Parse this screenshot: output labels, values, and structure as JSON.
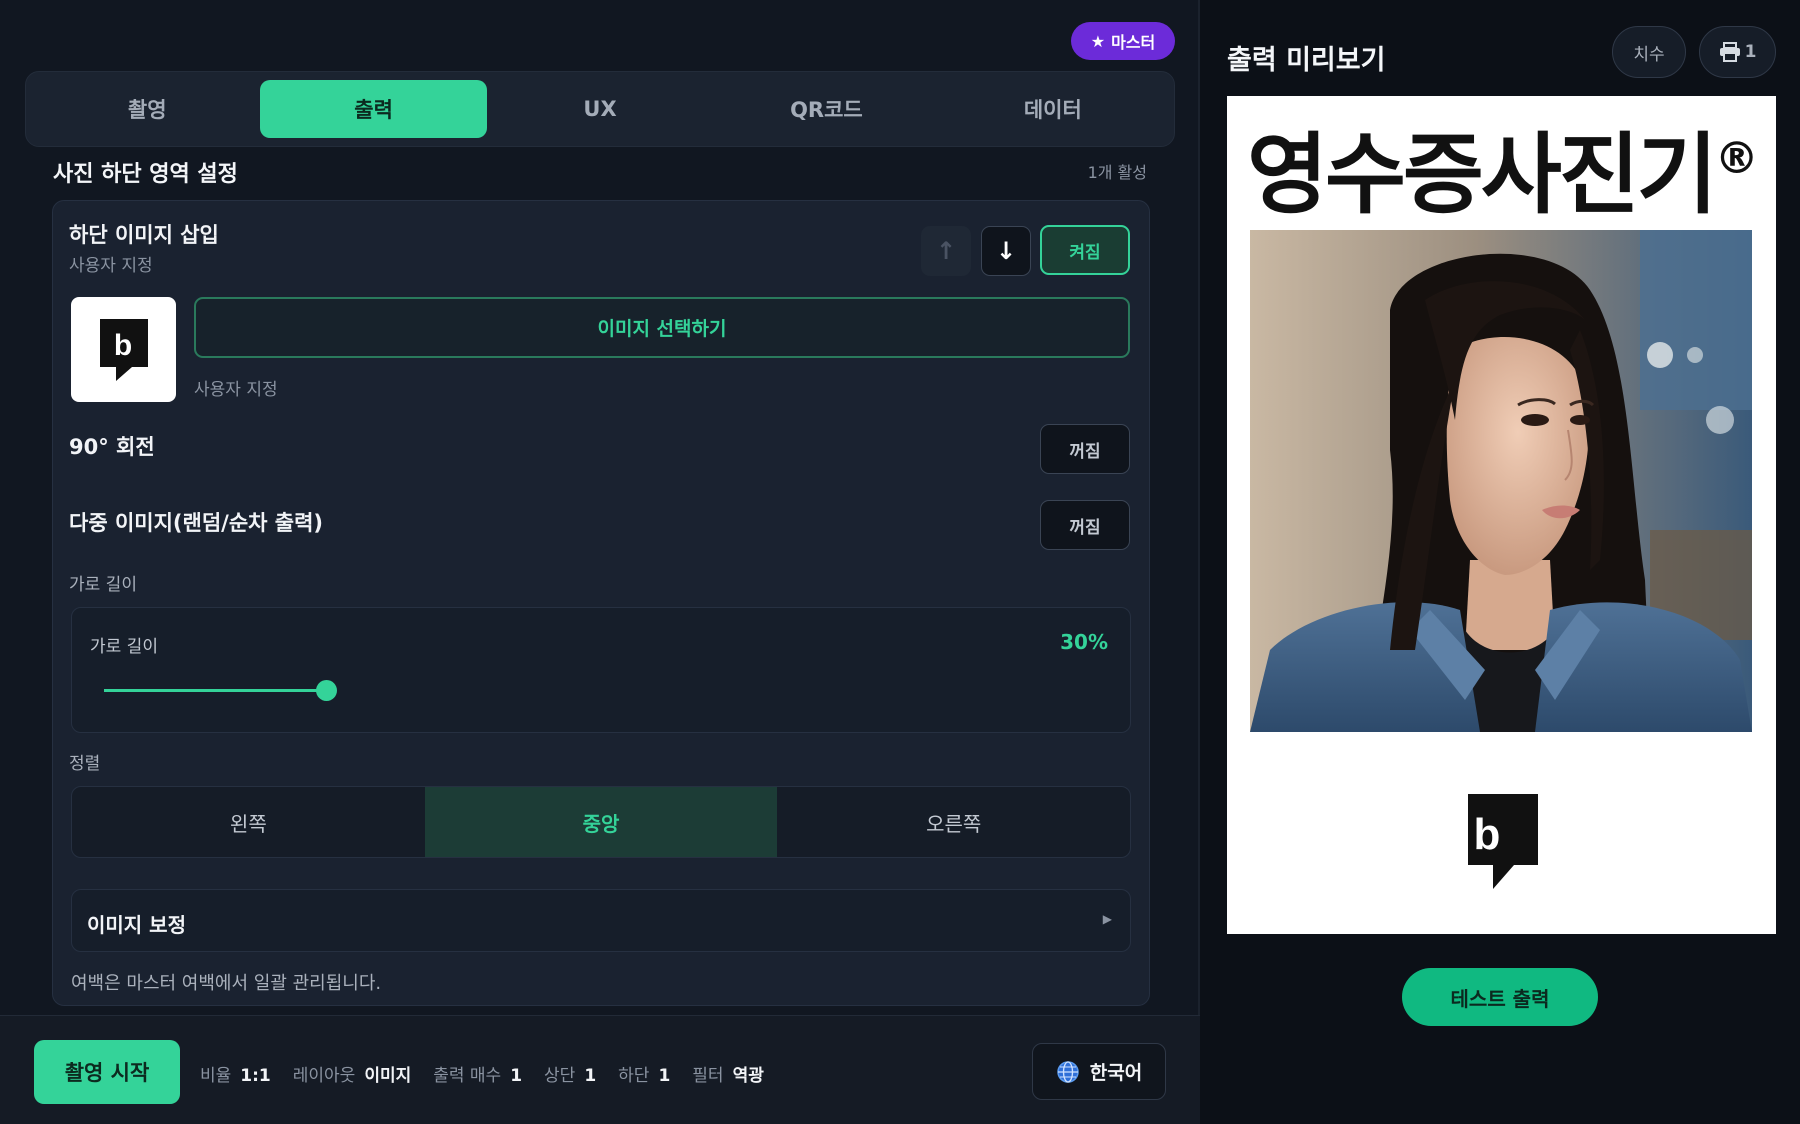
{
  "badge": {
    "label": "마스터"
  },
  "tabs": [
    {
      "label": "촬영"
    },
    {
      "label": "출력"
    },
    {
      "label": "UX"
    },
    {
      "label": "QR코드"
    },
    {
      "label": "데이터"
    }
  ],
  "active_tab": "출력",
  "section": {
    "title": "사진 하단 영역 설정",
    "count": "1개 활성"
  },
  "card": {
    "title": "하단 이미지 삽입",
    "subtitle": "사용자 지정",
    "enabled_toggle": "켜짐",
    "select_image": "이미지 선택하기",
    "image_caption": "사용자 지정",
    "rotate": {
      "label": "90° 회전",
      "toggle": "꺼짐"
    },
    "multi": {
      "label": "다중 이미지(랜덤/순차 출력)",
      "toggle": "꺼짐"
    },
    "width_section": "가로 길이",
    "slider": {
      "label": "가로 길이",
      "value_text": "30%",
      "value": 0.3
    },
    "align_section": "정렬",
    "align_options": [
      "왼쪽",
      "중앙",
      "오른쪽"
    ],
    "align_selected": "중앙",
    "correction": "이미지 보정",
    "note": "여백은 마스터 여백에서 일괄 관리됩니다."
  },
  "bottom": {
    "start": "촬영 시작",
    "stats": [
      {
        "k": "비율",
        "v": "1:1"
      },
      {
        "k": "레이아웃",
        "v": "이미지"
      },
      {
        "k": "출력 매수",
        "v": "1"
      },
      {
        "k": "상단",
        "v": "1"
      },
      {
        "k": "하단",
        "v": "1"
      },
      {
        "k": "필터",
        "v": "역광"
      }
    ],
    "language": "한국어"
  },
  "preview": {
    "title": "출력 미리보기",
    "size_btn": "치수",
    "print_count": "1",
    "paper_title": "영수증사진기",
    "paper_title_mark": "®",
    "test_print": "테스트 출력"
  },
  "colors": {
    "accent": "#34d399",
    "badge": "#6c2bd9",
    "bg": "#111721"
  }
}
